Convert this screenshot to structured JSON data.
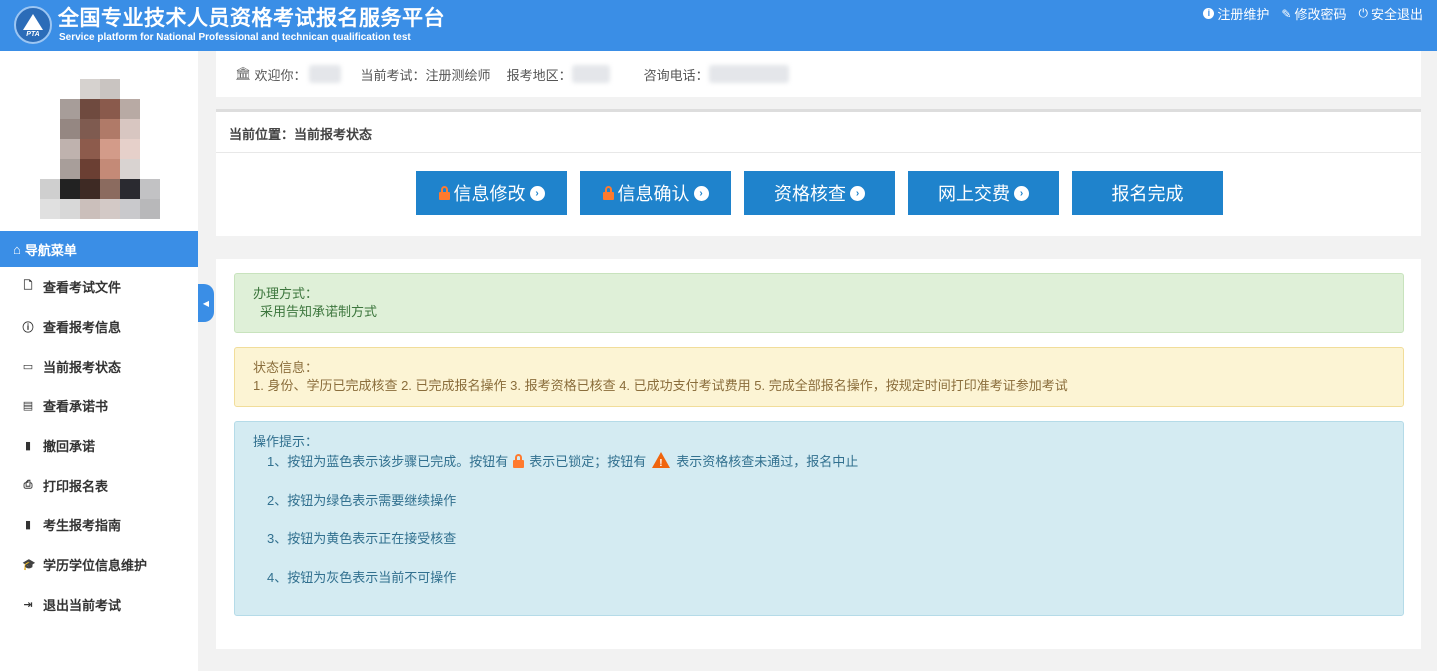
{
  "header": {
    "title": "全国专业技术人员资格考试报名服务平台",
    "subtitle": "Service platform for National Professional and technican qualification test",
    "logo_text": "PTA",
    "links": [
      {
        "label": "注册维护",
        "icon": "info-circle-icon"
      },
      {
        "label": "修改密码",
        "icon": "edit-icon"
      },
      {
        "label": "安全退出",
        "icon": "power-icon"
      }
    ]
  },
  "sidebar": {
    "nav_header": "导航菜单",
    "nav_header_icon": "home-icon",
    "items": [
      {
        "label": "查看考试文件",
        "icon": "file-icon"
      },
      {
        "label": "查看报考信息",
        "icon": "info-circle-icon"
      },
      {
        "label": "当前报考状态",
        "icon": "monitor-icon"
      },
      {
        "label": "查看承诺书",
        "icon": "id-card-icon"
      },
      {
        "label": "撤回承诺",
        "icon": "book-icon"
      },
      {
        "label": "打印报名表",
        "icon": "print-icon"
      },
      {
        "label": "考生报考指南",
        "icon": "book-icon"
      },
      {
        "label": "学历学位信息维护",
        "icon": "graduation-cap-icon"
      },
      {
        "label": "退出当前考试",
        "icon": "sign-out-icon"
      }
    ]
  },
  "infobar": {
    "welcome_label": "欢迎你：",
    "exam_label": "当前考试：",
    "exam_value": "注册测绘师",
    "region_label": "报考地区：",
    "phone_label": "咨询电话："
  },
  "status": {
    "breadcrumb": "当前位置：当前报考状态",
    "steps": [
      {
        "label": "信息修改",
        "locked": true,
        "arrow": true
      },
      {
        "label": "信息确认",
        "locked": true,
        "arrow": true
      },
      {
        "label": "资格核查",
        "locked": false,
        "arrow": true
      },
      {
        "label": "网上交费",
        "locked": false,
        "arrow": true
      },
      {
        "label": "报名完成",
        "locked": false,
        "arrow": false
      }
    ],
    "step_color": "#1f83cc",
    "lock_color": "#ff7a2e"
  },
  "alerts": {
    "method_title": "办理方式：",
    "method_text": "采用告知承诺制方式",
    "status_title": "状态信息：",
    "status_text": "1. 身份、学历已完成核查 2. 已完成报名操作 3. 报考资格已核查 4. 已成功支付考试费用 5. 完成全部报名操作，按规定时间打印准考证参加考试",
    "tips_title": "操作提示：",
    "tip1_a": "1、按钮为蓝色表示该步骤已完成。按钮有",
    "tip1_b": "表示已锁定；按钮有",
    "tip1_c": "表示资格核查未通过，报名中止",
    "tip2": "2、按钮为绿色表示需要继续操作",
    "tip3": "3、按钮为黄色表示正在接受核查",
    "tip4": "4、按钮为灰色表示当前不可操作"
  }
}
